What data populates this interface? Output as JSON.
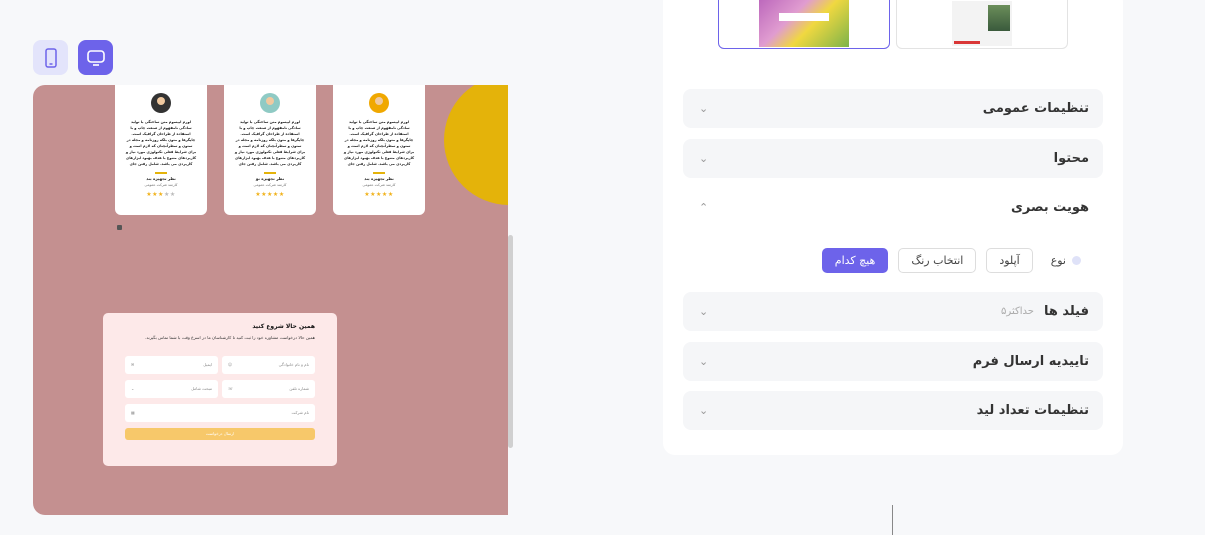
{
  "device_toggle": {
    "mobile_icon": "mobile-icon",
    "desktop_icon": "desktop-icon",
    "active": "desktop"
  },
  "preview": {
    "testimonials": [
      {
        "text": "لورم ایپسوم متن ساختگی با تولید سادگی نامفهوم از صنعت چاپ و با استفاده از طراحان گرافیک است. چاپگرها و متون بلکه روزنامه و مجله در ستون و سطرآنچنان که لازم است و برای شرایط فعلی تکنولوژی مورد نیاز و کاربردهای متنوع با هدف بهبود ابزارهای کاربردی می باشد. شامل رفتن جای",
        "name": "نظر تجهیزه بند",
        "role": "کارمند شرکت عمومی",
        "stars": 5
      },
      {
        "text": "لورم ایپسوم متن ساختگی با تولید سادگی نامفهوم از صنعت چاپ و با استفاده از طراحان گرافیک است. چاپگرها و متون بلکه روزنامه و مجله در ستون و سطرآنچنان که لازم است و برای شرایط فعلی تکنولوژی مورد نیاز و کاربردهای متنوع با هدف بهبود ابزارهای کاربردی می باشد. شامل رفتن جای",
        "name": "نظر تجهیزه نو",
        "role": "کارمند شرکت عمومی",
        "stars": 5
      },
      {
        "text": "لورم ایپسوم متن ساختگی با تولید سادگی نامفهوم از صنعت چاپ و با استفاده از طراحان گرافیک است. چاپگرها و متون بلکه روزنامه و مجله در ستون و سطرآنچنان که لازم است و برای شرایط فعلی تکنولوژی مورد نیاز و کاربردهای متنوع با هدف بهبود ابزارهای کاربردی می باشد. شامل رفتن جای",
        "name": "نظر تجهیزه بند",
        "role": "کارمند شرکت عمومی",
        "stars": 3
      }
    ],
    "form": {
      "title": "همین حالا شروع کنید",
      "description": "همین حالا درخواست مشاوره خود را ثبت کنید تا کارشناسان ما در اسرع وقت با شما تماس بگیرند.",
      "fields": {
        "full_name": "نام و نام خانوادگی",
        "email": "ایمیل",
        "phone": "شماره تلفن",
        "subject": "مبحث شامل",
        "title_field": "نام شرکت"
      },
      "submit": "ارسال درخواست"
    },
    "colors": {
      "background": "#c49090",
      "accent": "#e4b30a",
      "form_bg": "#fde9e9",
      "submit": "#f7c86a"
    }
  },
  "settings": {
    "sections": [
      {
        "title": "تنظیمات عمومی",
        "expanded": false
      },
      {
        "title": "محتوا",
        "expanded": false
      },
      {
        "title": "هویت بصری",
        "expanded": true
      },
      {
        "title": "فیلد ها",
        "hint": "حداکثر۵",
        "expanded": false
      },
      {
        "title": "تاییدیه ارسال فرم",
        "expanded": false
      },
      {
        "title": "تنظیمات تعداد لید",
        "expanded": false
      }
    ],
    "visual_identity": {
      "type_label": "نوع",
      "options": [
        "آپلود",
        "انتخاب رنگ",
        "هیچ کدام"
      ],
      "selected": "هیچ کدام"
    },
    "accent_color": "#6d63ea"
  }
}
